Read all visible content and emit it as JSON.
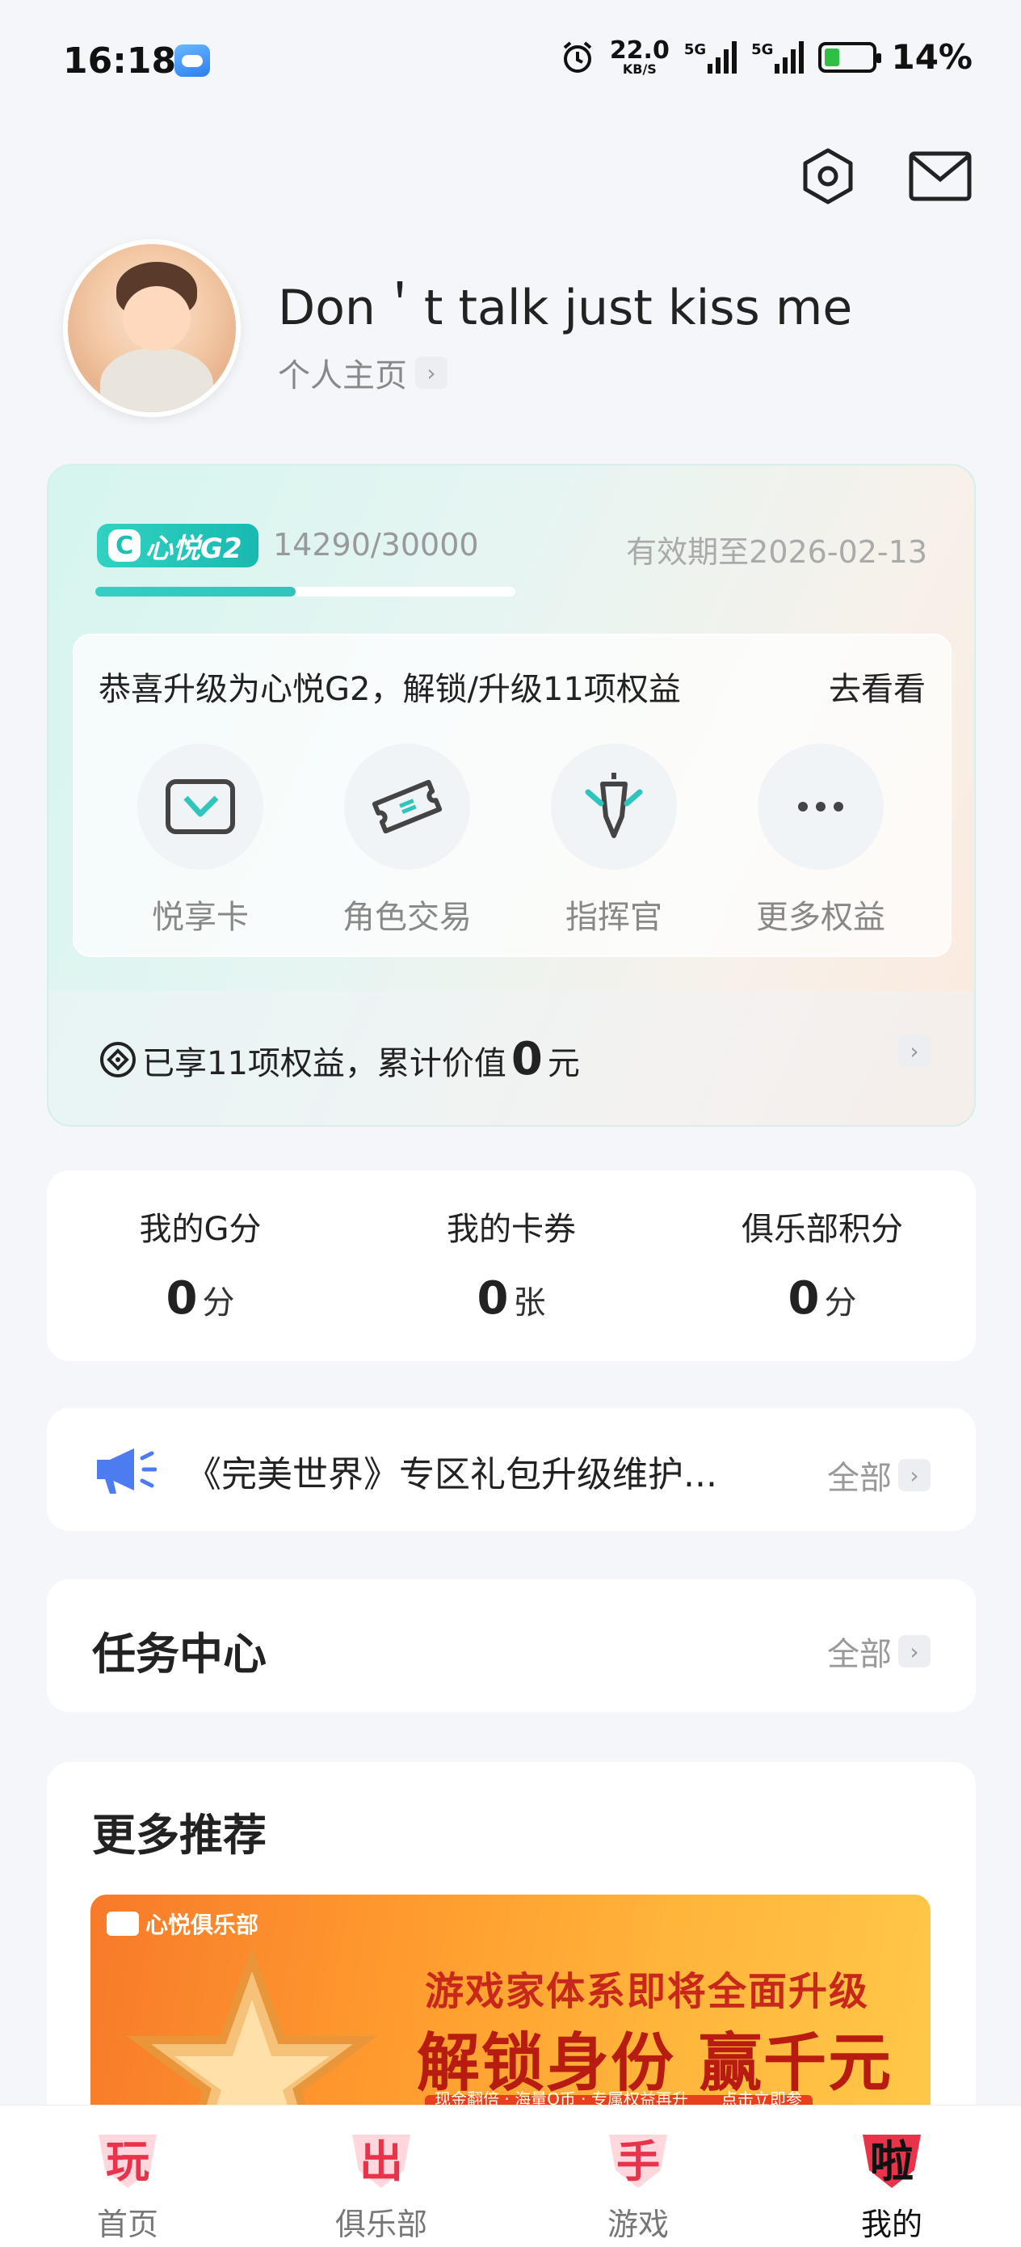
{
  "status_bar": {
    "time": "16:18",
    "net_speed": "22.0",
    "net_unit": "KB/S",
    "sig1": "5G",
    "sig2": "5G",
    "battery": "14%"
  },
  "profile": {
    "username": "Don＇t talk just kiss me",
    "subtitle": "个人主页"
  },
  "vip": {
    "badge": "心悦G2",
    "badge_letter": "C",
    "progress_text": "14290/30000",
    "progress_fraction": 0.4763,
    "expire": "有效期至2026-02-13",
    "upgrade_text": "恭喜升级为心悦G2，解锁/升级11项权益",
    "view_link": "去看看",
    "benefits": [
      {
        "label": "悦享卡",
        "icon": "card-icon"
      },
      {
        "label": "角色交易",
        "icon": "ticket-icon"
      },
      {
        "label": "指挥官",
        "icon": "sword-icon"
      },
      {
        "label": "更多权益",
        "icon": "more-icon"
      }
    ],
    "footer_prefix": "已享11项权益，累计价值",
    "footer_value": "0",
    "footer_unit": "元"
  },
  "stats": [
    {
      "title": "我的G分",
      "value": "0",
      "unit": "分"
    },
    {
      "title": "我的卡券",
      "value": "0",
      "unit": "张"
    },
    {
      "title": "俱乐部积分",
      "value": "0",
      "unit": "分"
    }
  ],
  "notice": {
    "text": "《完美世界》专区礼包升级维护...",
    "all": "全部"
  },
  "tasks": {
    "title": "任务中心",
    "all": "全部"
  },
  "more": {
    "title": "更多推荐",
    "banner_logo": "心悦俱乐部",
    "banner_sub": "游戏家体系即将全面升级",
    "banner_main": "解锁身份 赢千元奖励",
    "banner_strip_left": "现金翻倍 · 海量Q币 · 专属权益再升级",
    "banner_strip_right": "点击立即参与"
  },
  "nav": [
    {
      "label": "首页",
      "glyph": "玩",
      "active": false
    },
    {
      "label": "俱乐部",
      "glyph": "出",
      "active": false
    },
    {
      "label": "游戏",
      "glyph": "手",
      "active": false
    },
    {
      "label": "我的",
      "glyph": "啦",
      "active": true
    }
  ],
  "colors": {
    "accent": "#2fc5bd",
    "nav_red": "#e8334a",
    "banner_orange": "#ff9a2e"
  }
}
